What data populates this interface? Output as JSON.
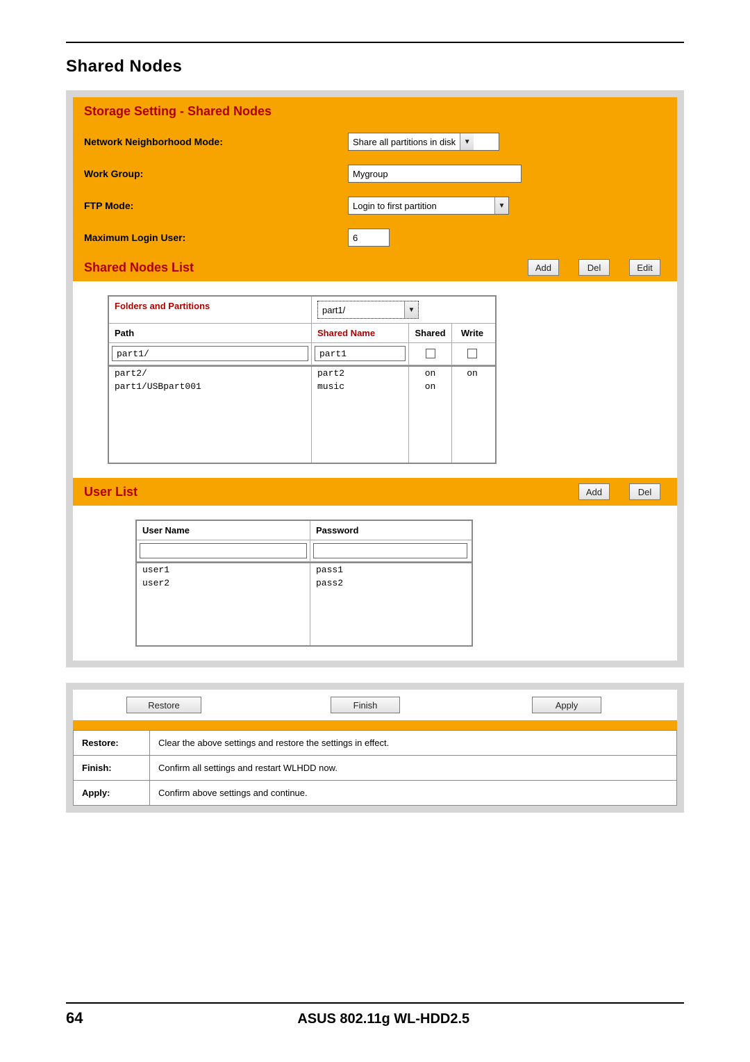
{
  "page": {
    "title": "Shared Nodes",
    "number": "64",
    "footer_title": "ASUS 802.11g WL-HDD2.5"
  },
  "panel1": {
    "title": "Storage Setting - Shared Nodes",
    "settings": {
      "nn_mode_label": "Network Neighborhood Mode:",
      "nn_mode_value": "Share all partitions in disk",
      "workgroup_label": "Work Group:",
      "workgroup_value": "Mygroup",
      "ftp_label": "FTP Mode:",
      "ftp_value": "Login to first partition",
      "maxuser_label": "Maximum Login User:",
      "maxuser_value": "6"
    },
    "shared_list": {
      "title": "Shared Nodes List",
      "add": "Add",
      "del": "Del",
      "edit": "Edit",
      "fp_label": "Folders and Partitions",
      "fp_value": "part1/",
      "col_path": "Path",
      "col_name": "Shared Name",
      "col_shared": "Shared",
      "col_write": "Write",
      "row0_path": "part1/",
      "row0_name": "part1",
      "row1_path": "part2/",
      "row1_name": "part2",
      "row1_shared": "on",
      "row1_write": "on",
      "row2_path": "part1/USBpart001",
      "row2_name": "music",
      "row2_shared": "on",
      "row2_write": ""
    },
    "user_list": {
      "title": "User List",
      "add": "Add",
      "del": "Del",
      "col_user": "User Name",
      "col_pass": "Password",
      "u1": "user1",
      "p1": "pass1",
      "u2": "user2",
      "p2": "pass2"
    }
  },
  "panel2": {
    "restore_btn": "Restore",
    "finish_btn": "Finish",
    "apply_btn": "Apply",
    "desc_restore_key": "Restore:",
    "desc_restore_val": "Clear the above settings and restore the settings in effect.",
    "desc_finish_key": "Finish:",
    "desc_finish_val": "Confirm all settings and restart WLHDD now.",
    "desc_apply_key": "Apply:",
    "desc_apply_val": "Confirm above settings and continue."
  }
}
